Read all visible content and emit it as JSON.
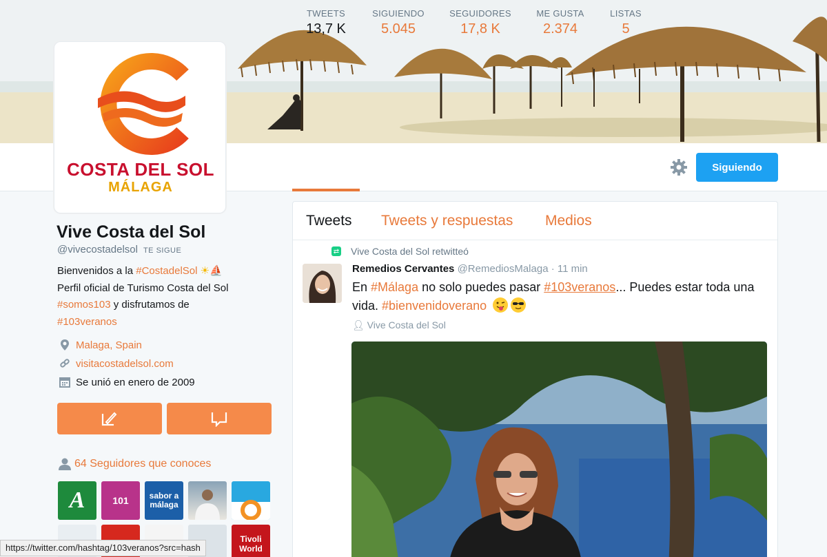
{
  "profile": {
    "name": "Vive Costa del Sol",
    "handle": "@vivecostadelsol",
    "follows_you": "TE SIGUE",
    "logo_line1": "COSTA DEL SOL",
    "logo_line2": "MÁLAGA",
    "bio": {
      "line1_prefix": "Bienvenidos a la ",
      "line1_hashtag": "#CostadelSol",
      "line2": "Perfil oficial de Turismo Costa del Sol",
      "line3_hashtag": "#somos103",
      "line3_suffix": " y disfrutamos de",
      "line4_hashtag": "#103veranos"
    },
    "location": "Malaga, Spain",
    "website": "visitacostadelsol.com",
    "joined": "Se unió en enero de 2009",
    "followers_you_know": "64 Seguidores que conoces"
  },
  "stats": [
    {
      "label": "TWEETS",
      "value": "13,7 K"
    },
    {
      "label": "SIGUIENDO",
      "value": "5.045"
    },
    {
      "label": "SEGUIDORES",
      "value": "17,8 K"
    },
    {
      "label": "ME GUSTA",
      "value": "2.374"
    },
    {
      "label": "LISTAS",
      "value": "5"
    }
  ],
  "follow_button": "Siguiendo",
  "tabs": [
    "Tweets",
    "Tweets y respuestas",
    "Medios"
  ],
  "tweet": {
    "retweeted_by": "Vive Costa del Sol retwitteó",
    "author_name": "Remedios Cervantes",
    "author_handle": "@RemediosMalaga",
    "time": "· 11 min",
    "text_1": "En ",
    "hashtag_1": "#Málaga",
    "text_2": " no solo puedes pasar ",
    "hashtag_2": "#103veranos",
    "text_3": "... Puedes estar toda una vida. ",
    "hashtag_3": "#bienvenidoverano",
    "tagged_user": "Vive Costa del Sol"
  },
  "follower_thumbs": [
    "A",
    "101",
    "sabor a málaga",
    "",
    "",
    "",
    "",
    "",
    "",
    "Tivoli World"
  ],
  "status_url": "https://twitter.com/hashtag/103veranos?src=hash",
  "colors": {
    "accent_orange": "#e8793a",
    "follow_blue": "#1da1f2",
    "retweet_green": "#19cf86"
  },
  "icons": [
    "settings-gear-icon",
    "location-pin-icon",
    "link-icon",
    "calendar-icon",
    "tweet-to-icon",
    "message-icon",
    "person-icon",
    "retweet-icon"
  ]
}
